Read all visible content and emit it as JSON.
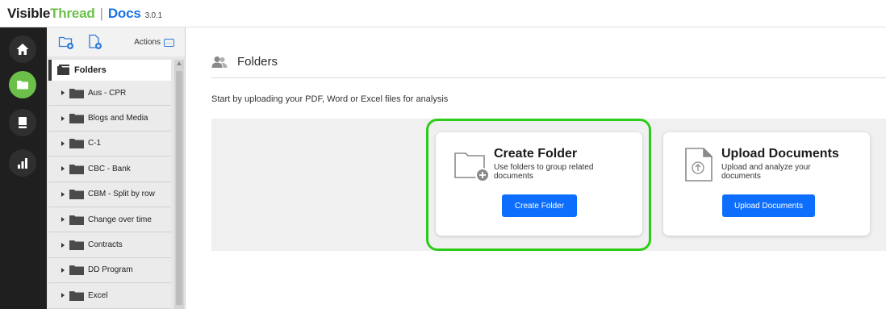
{
  "header": {
    "brand_part1": "Visible",
    "brand_part2": "Thread",
    "separator": "|",
    "product": "Docs",
    "version": "3.0.1"
  },
  "rail": {
    "items": [
      {
        "icon": "home-icon",
        "active": false
      },
      {
        "icon": "folder-icon",
        "active": true
      },
      {
        "icon": "book-icon",
        "active": false
      },
      {
        "icon": "bar-chart-icon",
        "active": false
      }
    ]
  },
  "tree": {
    "toolbar": {
      "new_folder_icon": "new-folder-icon",
      "new_document_icon": "new-document-icon",
      "actions_label": "Actions",
      "actions_icon_glyph": "…"
    },
    "root_label": "Folders",
    "items": [
      {
        "label": "Aus - CPR"
      },
      {
        "label": "Blogs and Media"
      },
      {
        "label": "C-1"
      },
      {
        "label": "CBC - Bank"
      },
      {
        "label": "CBM - Split by row"
      },
      {
        "label": "Change over time"
      },
      {
        "label": "Contracts"
      },
      {
        "label": "DD Program"
      },
      {
        "label": "Excel"
      }
    ]
  },
  "main": {
    "title": "Folders",
    "subtitle": "Start by uploading your PDF, Word or Excel files for analysis",
    "cards": {
      "create_folder": {
        "title": "Create Folder",
        "description": "Use folders to group related documents",
        "button": "Create Folder"
      },
      "upload_documents": {
        "title": "Upload Documents",
        "description": "Upload and analyze your documents",
        "button": "Upload Documents"
      }
    }
  },
  "colors": {
    "brand_green": "#6cc04a",
    "brand_blue": "#1a73e8",
    "button_blue": "#0d6efd",
    "highlight_green": "#2ecc1a",
    "rail_bg": "#1f1f1f"
  }
}
